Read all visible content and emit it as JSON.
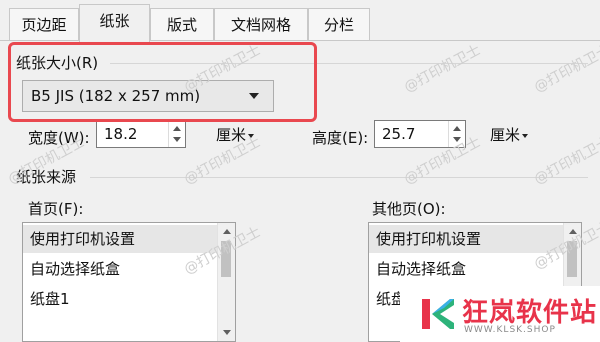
{
  "tabs": [
    {
      "label": "页边距",
      "active": false
    },
    {
      "label": "纸张",
      "active": true
    },
    {
      "label": "版式",
      "active": false
    },
    {
      "label": "文档网格",
      "active": false
    },
    {
      "label": "分栏",
      "active": false
    }
  ],
  "paper_size": {
    "section_label": "纸张大小(R)",
    "selected": "B5 JIS (182 x 257 mm)"
  },
  "width": {
    "label": "宽度(W):",
    "value": "18.2",
    "unit": "厘米"
  },
  "height": {
    "label": "高度(E):",
    "value": "25.7",
    "unit": "厘米"
  },
  "paper_source": {
    "section_label": "纸张来源",
    "first_page": {
      "label": "首页(F):",
      "items": [
        "使用打印机设置",
        "自动选择纸盒",
        "纸盘1"
      ],
      "selected_index": 0
    },
    "other_pages": {
      "label": "其他页(O):",
      "items": [
        "使用打印机设置",
        "自动选择纸盒",
        "纸盘1"
      ],
      "selected_index": 0
    }
  },
  "watermark": "@打印机卫士",
  "logo": {
    "name": "狂岚软件站",
    "url": "WWW.KLSK.SHOP",
    "accent": "#e8334a"
  }
}
